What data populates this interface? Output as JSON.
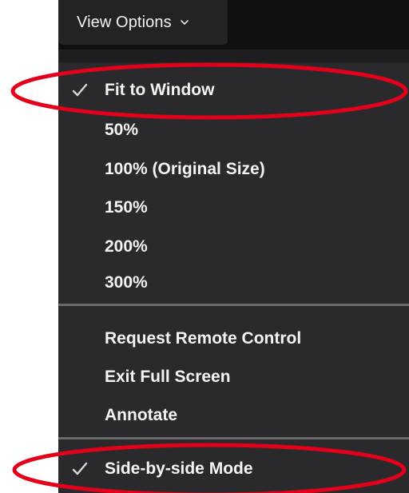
{
  "button": {
    "label": "View Options",
    "chevron_icon": "chevron-down-icon"
  },
  "menu": {
    "zoom_items": [
      {
        "label": "Fit to Window",
        "checked": true
      },
      {
        "label": "50%",
        "checked": false
      },
      {
        "label": "100% (Original Size)",
        "checked": false
      },
      {
        "label": "150%",
        "checked": false
      },
      {
        "label": "200%",
        "checked": false
      },
      {
        "label": "300%",
        "checked": false
      }
    ],
    "action_items": [
      {
        "label": "Request Remote Control"
      },
      {
        "label": "Exit Full Screen"
      },
      {
        "label": "Annotate"
      }
    ],
    "mode_items": [
      {
        "label": "Side-by-side Mode",
        "checked": true
      }
    ]
  },
  "colors": {
    "menu_background": "#2a2a2c",
    "text": "#f4f4f4",
    "annotation": "#e3001b"
  }
}
